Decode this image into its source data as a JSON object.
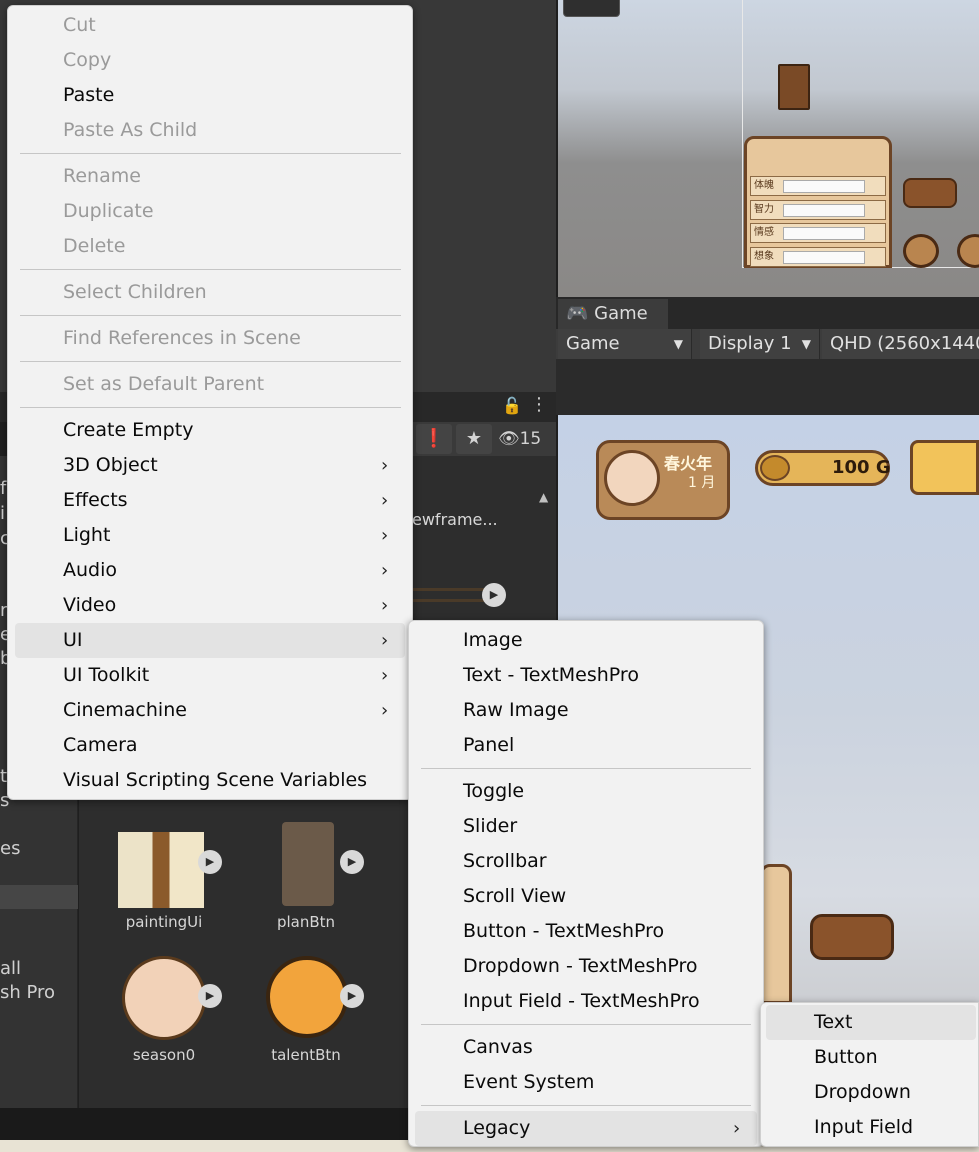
{
  "context_menu": {
    "items": [
      {
        "label": "Cut",
        "enabled": false
      },
      {
        "label": "Copy",
        "enabled": false
      },
      {
        "label": "Paste",
        "enabled": true
      },
      {
        "label": "Paste As Child",
        "enabled": false
      },
      {
        "label": "Rename",
        "enabled": false
      },
      {
        "label": "Duplicate",
        "enabled": false
      },
      {
        "label": "Delete",
        "enabled": false
      },
      {
        "label": "Select Children",
        "enabled": false
      },
      {
        "label": "Find References in Scene",
        "enabled": false
      },
      {
        "label": "Set as Default Parent",
        "enabled": false
      },
      {
        "label": "Create Empty",
        "enabled": true
      },
      {
        "label": "3D Object",
        "enabled": true,
        "submenu": true
      },
      {
        "label": "Effects",
        "enabled": true,
        "submenu": true
      },
      {
        "label": "Light",
        "enabled": true,
        "submenu": true
      },
      {
        "label": "Audio",
        "enabled": true,
        "submenu": true
      },
      {
        "label": "Video",
        "enabled": true,
        "submenu": true
      },
      {
        "label": "UI",
        "enabled": true,
        "submenu": true,
        "highlighted": true
      },
      {
        "label": "UI Toolkit",
        "enabled": true,
        "submenu": true
      },
      {
        "label": "Cinemachine",
        "enabled": true,
        "submenu": true
      },
      {
        "label": "Camera",
        "enabled": true
      },
      {
        "label": "Visual Scripting Scene Variables",
        "enabled": true
      }
    ],
    "submenu_arrow": "›"
  },
  "ui_submenu": {
    "items": [
      {
        "label": "Image"
      },
      {
        "label": "Text - TextMeshPro"
      },
      {
        "label": "Raw Image"
      },
      {
        "label": "Panel"
      },
      {
        "label": "Toggle"
      },
      {
        "label": "Slider"
      },
      {
        "label": "Scrollbar"
      },
      {
        "label": "Scroll View"
      },
      {
        "label": "Button - TextMeshPro"
      },
      {
        "label": "Dropdown - TextMeshPro"
      },
      {
        "label": "Input Field - TextMeshPro"
      },
      {
        "label": "Canvas"
      },
      {
        "label": "Event System"
      },
      {
        "label": "Legacy",
        "submenu": true,
        "highlighted": true
      }
    ]
  },
  "legacy_submenu": {
    "items": [
      {
        "label": "Text",
        "highlighted": true
      },
      {
        "label": "Button"
      },
      {
        "label": "Dropdown"
      },
      {
        "label": "Input Field"
      }
    ]
  },
  "game_window": {
    "tab_label": "Game",
    "mode_dropdown": "Game",
    "display_dropdown": "Display 1",
    "resolution_dropdown": "QHD (2560x1440",
    "dropdown_arrow": "▼"
  },
  "hud": {
    "season_text": "春火年",
    "month_text": "1 月",
    "gold_text": "100 G"
  },
  "scene_stats": [
    "体魄",
    "智力",
    "情感",
    "想象"
  ],
  "project": {
    "visible_count": "15",
    "asset_fragment": "ewframe...",
    "left_fragments": [
      "f",
      "i",
      "c",
      "r",
      "e",
      "b",
      "t",
      "s",
      "es",
      "all",
      "sh Pro"
    ],
    "assets": [
      {
        "name": "paintingUi"
      },
      {
        "name": "planBtn"
      },
      {
        "name": "season0"
      },
      {
        "name": "talentBtn"
      }
    ]
  },
  "colors": {
    "menu_bg": "#f2f2f2",
    "menu_highlight": "#e3e3e3",
    "menu_disabled_text": "#9a9a9a",
    "editor_dark": "#383838"
  }
}
